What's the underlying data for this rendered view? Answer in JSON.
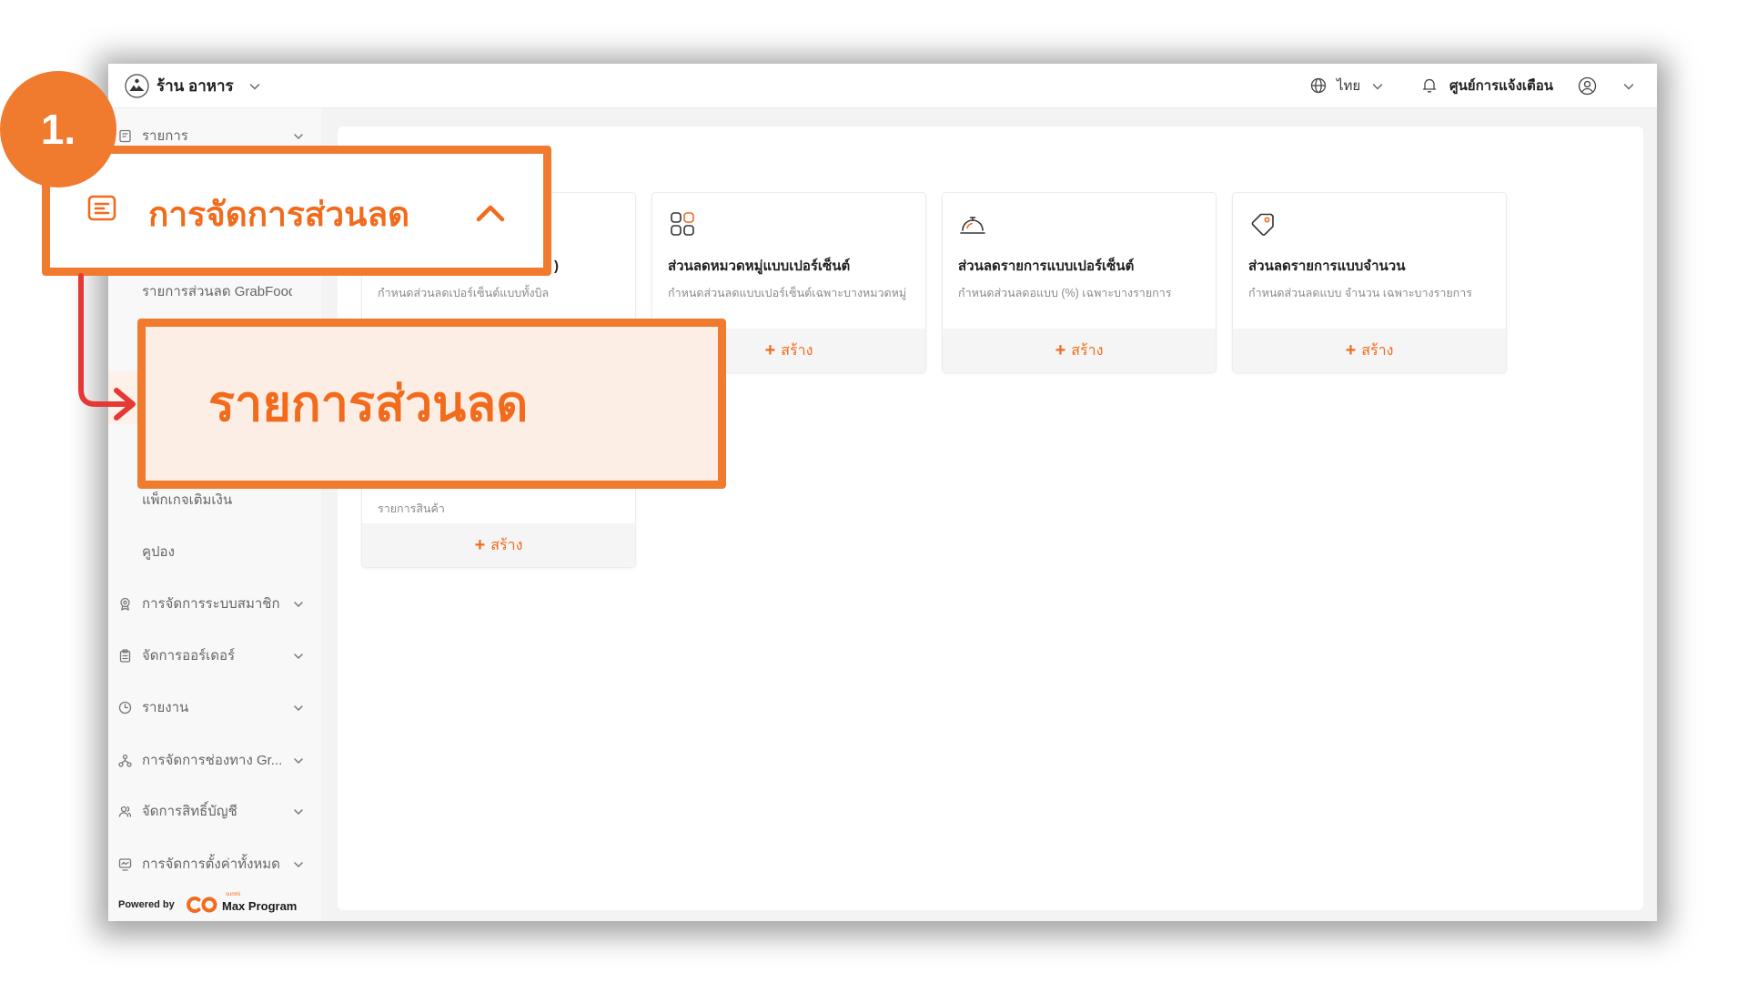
{
  "topbar": {
    "store_logo_icon": "store-logo",
    "store_name": "ร้าน อาหาร",
    "language": "ไทย",
    "notification_center": "ศูนย์การแจ้งเตือน",
    "icons": [
      "globe-icon",
      "bell-icon",
      "user-circle-icon",
      "chevron-down-icon"
    ]
  },
  "sidebar": {
    "items": [
      {
        "label": "รายการ",
        "icon": "receipt-icon",
        "expandable": true
      },
      {
        "label": "รายการส่วนลด GrabFood"
      },
      {
        "label": "แพ็กเกจเติมเงิน"
      },
      {
        "label": "คูปอง"
      },
      {
        "label": "การจัดการระบบสมาชิก",
        "icon": "member-badge-icon",
        "expandable": true
      },
      {
        "label": "จัดการออร์เดอร์",
        "icon": "clipboard-icon",
        "expandable": true
      },
      {
        "label": "รายงาน",
        "icon": "clock-icon",
        "expandable": true
      },
      {
        "label": "การจัดการช่องทาง Gr...",
        "icon": "channels-icon",
        "expandable": true
      },
      {
        "label": "จัดการสิทธิ์บัญชี",
        "icon": "users-icon",
        "expandable": true
      },
      {
        "label": "การจัดการตั้งค่าทั้งหมด",
        "icon": "monitor-settings-icon",
        "expandable": true
      }
    ],
    "footer": {
      "powered_by": "Powered by",
      "brand_tag": "sunmi",
      "brand": "Max Program"
    }
  },
  "discount_cards": [
    {
      "title": ")",
      "description": "กำหนดส่วนลดเปอร์เซ็นต์แบบทั้งบิล"
    },
    {
      "icon": "category-grid-icon",
      "title": "ส่วนลดหมวดหมู่แบบเปอร์เซ็นต์",
      "description": "กำหนดส่วนลดแบบเปอร์เซ็นต์เฉพาะบางหมวดหมู่",
      "action": "สร้าง"
    },
    {
      "icon": "cloche-icon",
      "title": "ส่วนลดรายการแบบเปอร์เซ็นต์",
      "description": "กำหนดส่วนลดอแบบ (%) เฉพาะบางรายการ",
      "action": "สร้าง"
    },
    {
      "icon": "price-tag-icon",
      "title": "ส่วนลดรายการแบบจำนวน",
      "description": "กำหนดส่วนลดแบบ จำนวน เฉพาะบางรายการ",
      "action": "สร้าง"
    },
    {
      "description": "รายการสินค้า",
      "action": "สร้าง"
    }
  ],
  "annotation": {
    "step_number": "1.",
    "menu_callout": "การจัดการส่วนลด",
    "menu_callout_icon": "receipt-icon",
    "item_callout": "รายการส่วนลด"
  },
  "colors": {
    "accent": "#F26B1D",
    "callout_border": "#F07A2E",
    "callout_fill": "#FDEEE5",
    "arrow": "#E53935"
  }
}
